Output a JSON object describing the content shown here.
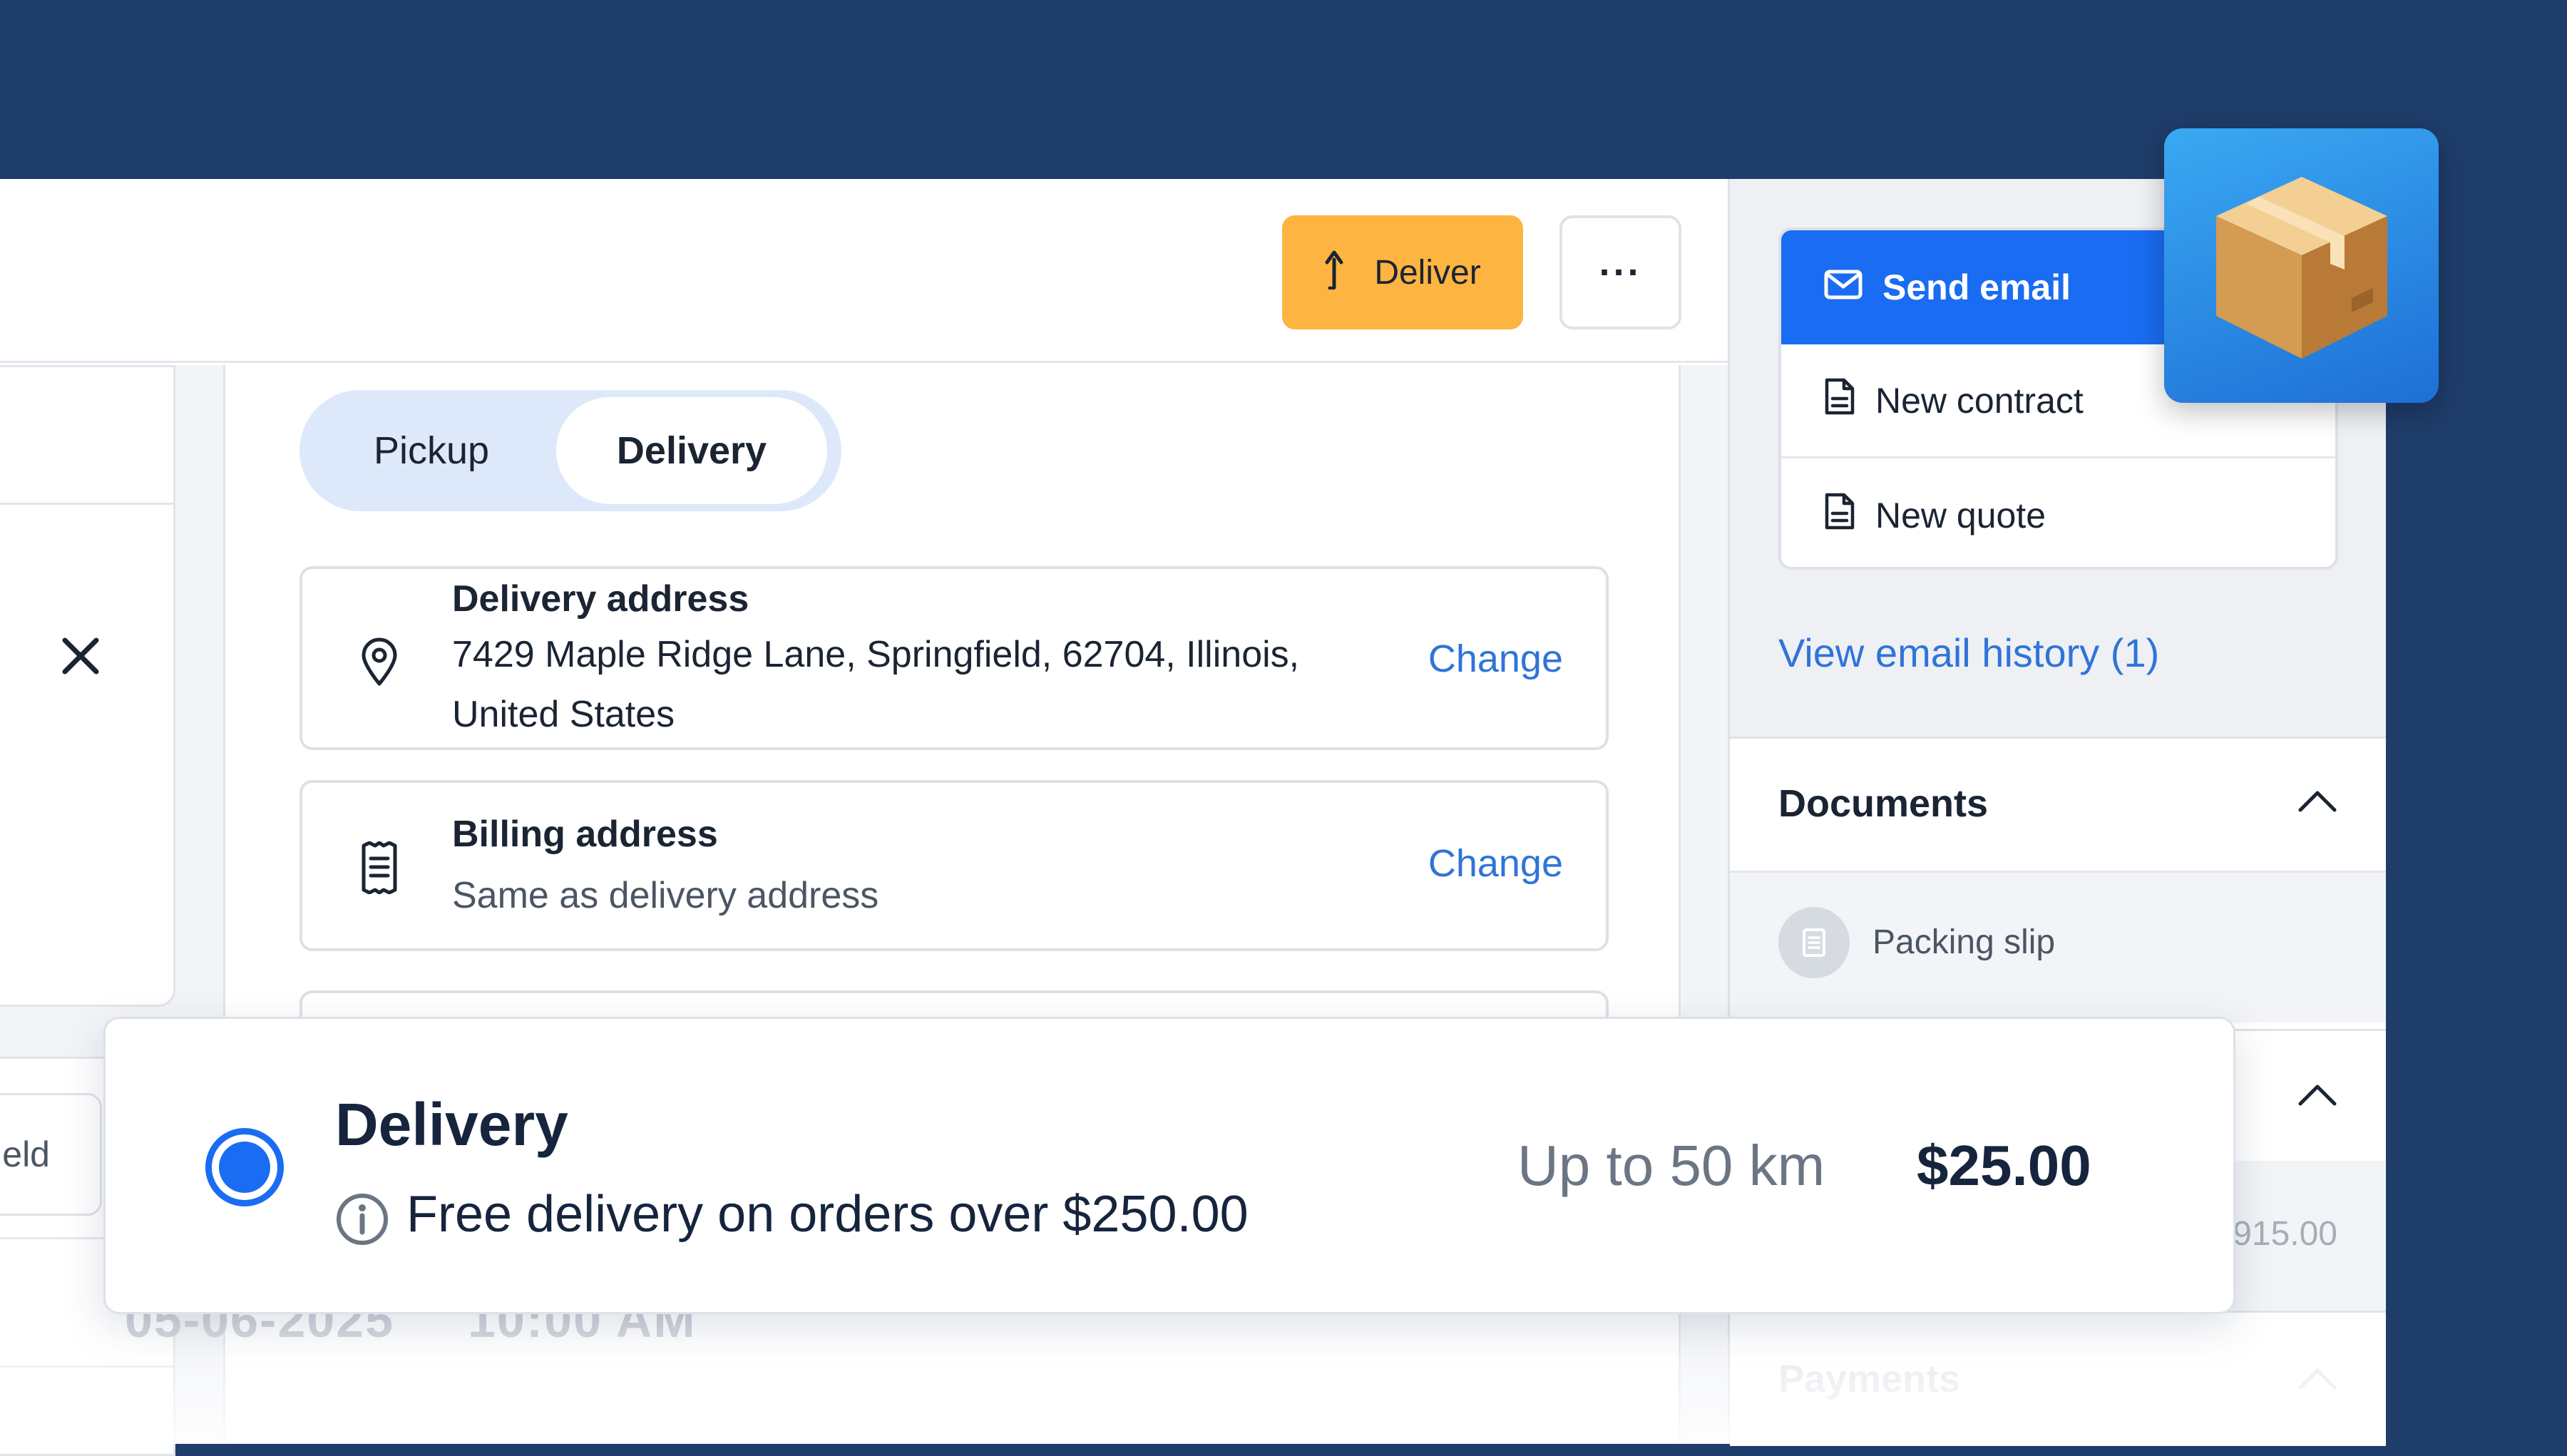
{
  "toolbar": {
    "deliver_label": "Deliver",
    "more_label": "···"
  },
  "left": {
    "field_partial": "eld"
  },
  "fulfillment_tabs": {
    "pickup": "Pickup",
    "delivery": "Delivery",
    "selected": "Delivery"
  },
  "delivery_address": {
    "title": "Delivery address",
    "line1": "7429 Maple Ridge Lane, Springfield, 62704, Illinois,",
    "line2": "United States",
    "change": "Change"
  },
  "billing_address": {
    "title": "Billing address",
    "text": "Same as delivery address",
    "change": "Change"
  },
  "schedule": {
    "date": "05-06-2025",
    "time": "10:00 AM"
  },
  "sidebar": {
    "actions": {
      "send_email": "Send email",
      "new_contract": "New contract",
      "new_quote": "New quote"
    },
    "email_history": "View email history (1)",
    "documents": {
      "title": "Documents",
      "items": [
        "Packing slip"
      ]
    },
    "summary_amount_partial": "915.00",
    "payments_title": "Payments"
  },
  "delivery_option": {
    "title": "Delivery",
    "note": "Free delivery on orders over $250.00",
    "range": "Up to 50 km",
    "price": "$25.00",
    "selected": true
  },
  "colors": {
    "background": "#1e3d6a",
    "accent_blue": "#1a6cf2",
    "deliver_yellow": "#fdb441",
    "link_blue": "#2f74d8"
  },
  "icons": {
    "deliver": "arrow-up-turn-icon",
    "close": "close-icon",
    "location": "map-pin-icon",
    "billing": "receipt-icon",
    "email": "envelope-icon",
    "document": "document-icon",
    "collapse": "chevron-up-icon",
    "info": "info-icon",
    "app": "package-box-icon"
  }
}
